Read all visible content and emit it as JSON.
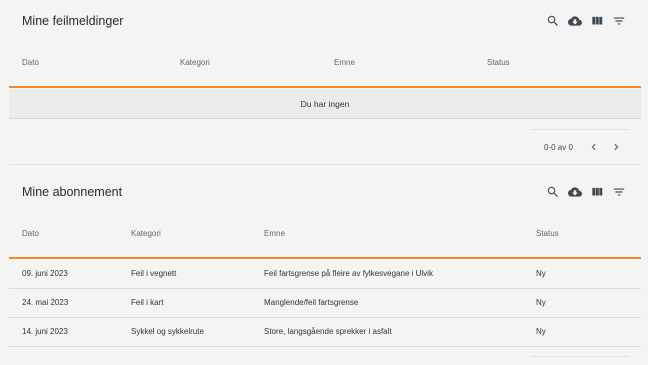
{
  "section1": {
    "title": "Mine feilmeldinger",
    "columns": [
      "Dato",
      "Kategori",
      "Emne",
      "Status"
    ],
    "empty_text": "Du har ingen",
    "pagination": "0-0 av 0"
  },
  "section2": {
    "title": "Mine abonnement",
    "columns": [
      "Dato",
      "Kategori",
      "Emne",
      "Status"
    ],
    "rows": [
      {
        "dato": "09. juni 2023",
        "kategori": "Feil i vegnett",
        "emne": "Feil fartsgrense på fleire av fylkesvegane i Ulvik",
        "status": "Ny"
      },
      {
        "dato": "24. mai 2023",
        "kategori": "Feil i kart",
        "emne": "Manglende/feil fartsgrense",
        "status": "Ny"
      },
      {
        "dato": "14. juni 2023",
        "kategori": "Sykkel og sykkelrute",
        "emne": "Store, langsgående sprekker i asfalt",
        "status": "Ny"
      }
    ]
  },
  "toolbar_icons": [
    "search-icon",
    "cloud-download-icon",
    "view-column-icon",
    "filter-icon"
  ],
  "colors": {
    "accent": "#f28c28",
    "background": "#f4f4f4",
    "icon": "#3f4a55"
  }
}
